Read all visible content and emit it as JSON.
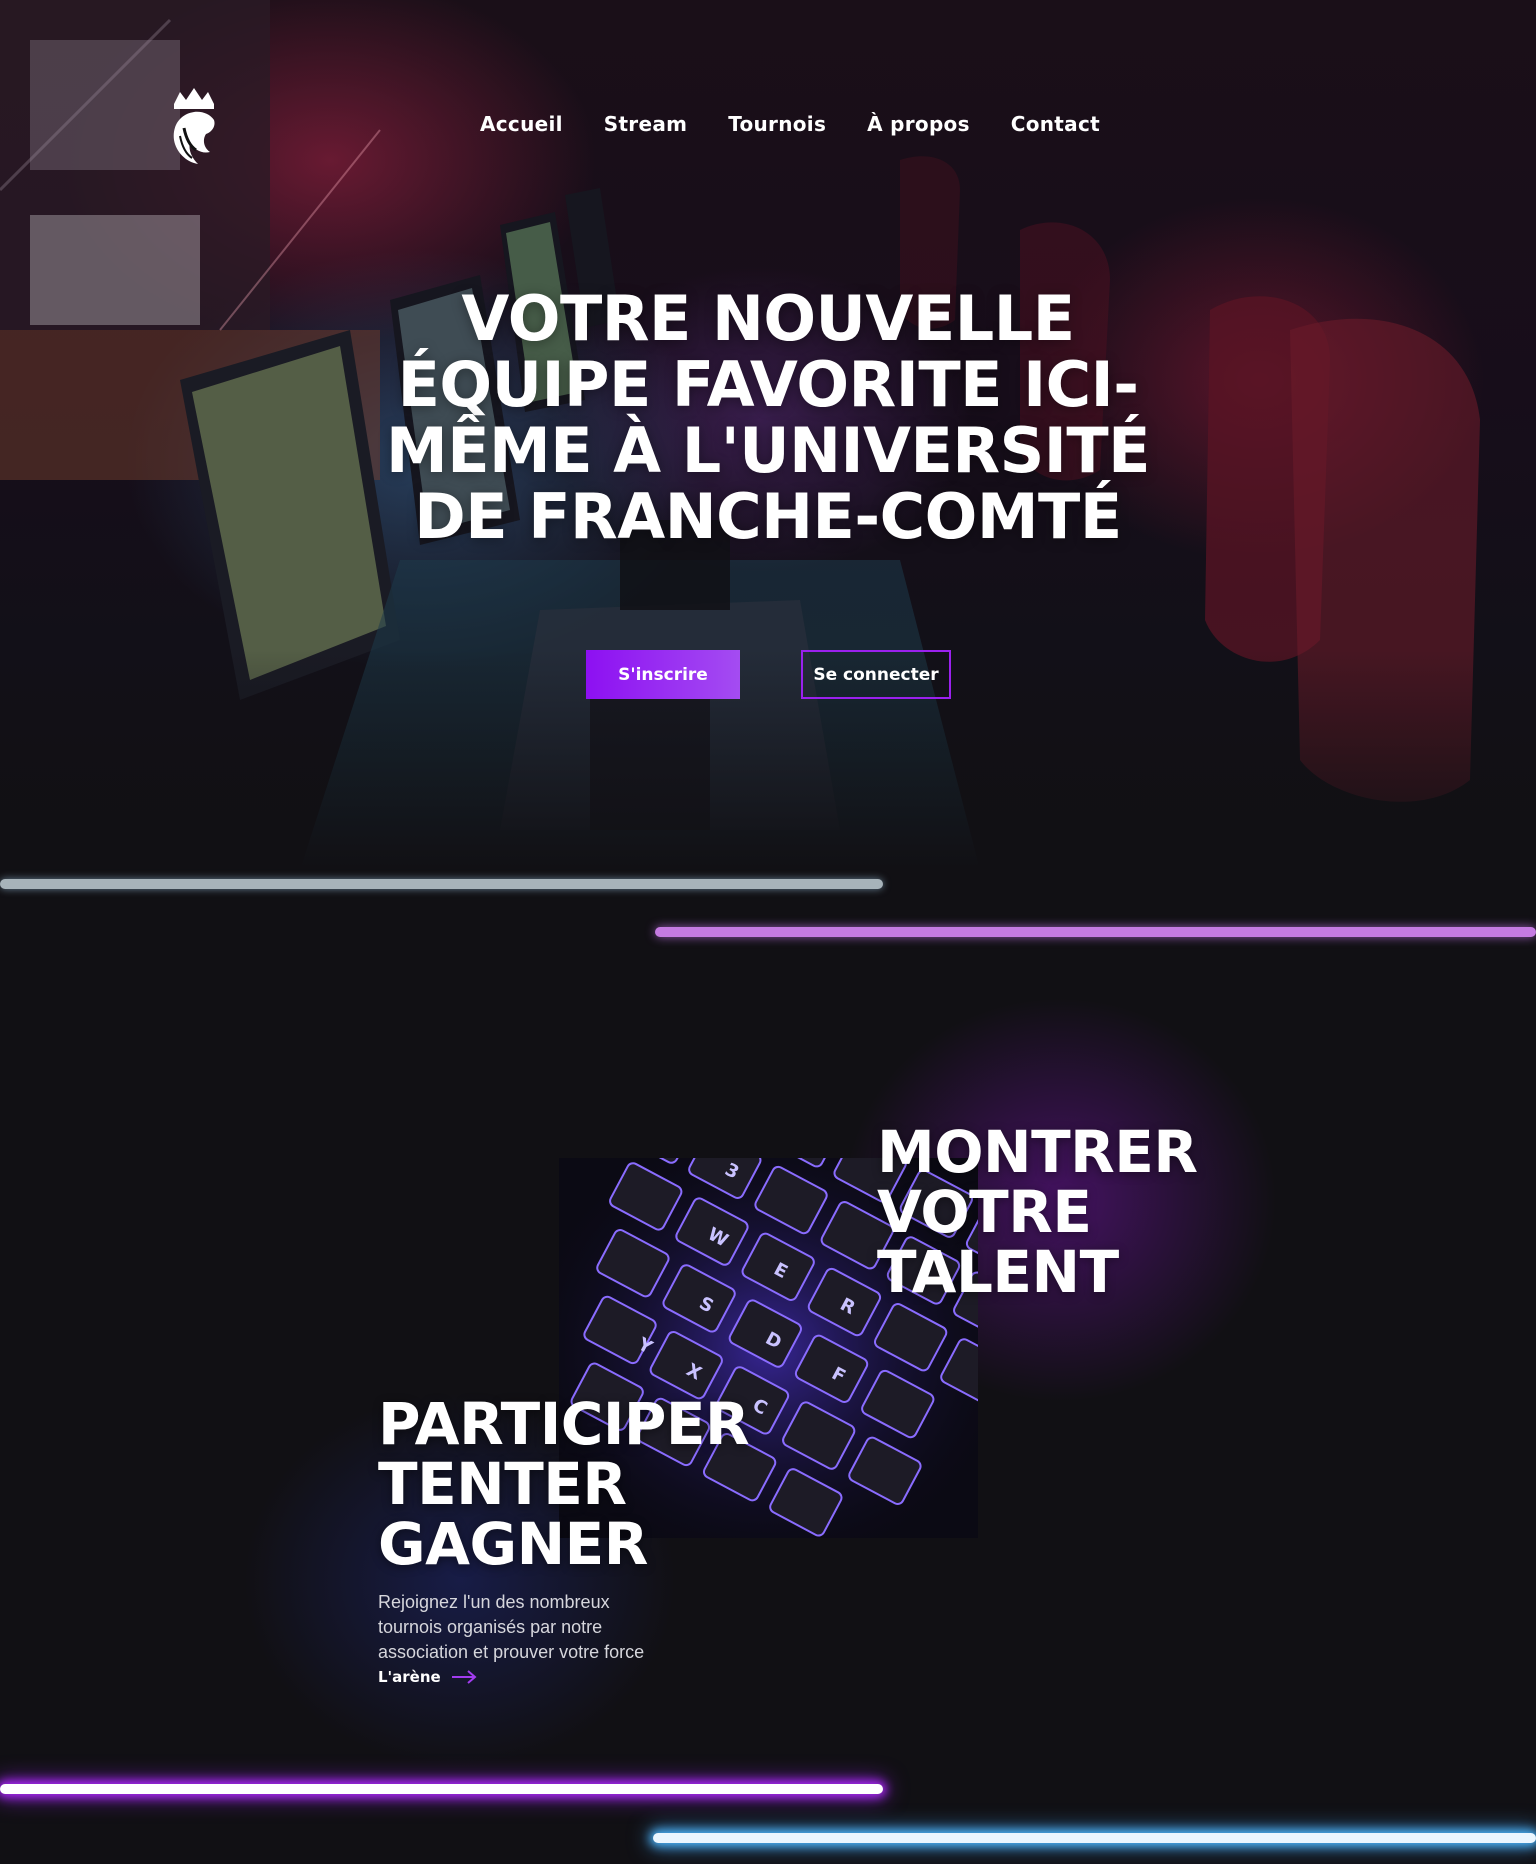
{
  "header": {
    "logo_icon": "crowned-lion-icon",
    "nav": [
      {
        "label": "Accueil"
      },
      {
        "label": "Stream"
      },
      {
        "label": "Tournois"
      },
      {
        "label": "À propos"
      },
      {
        "label": "Contact"
      }
    ]
  },
  "hero": {
    "title": "Votre nouvelle équipe favorite ici-même à l'Université de Franche-Comté",
    "primary_button": "S'inscrire",
    "secondary_button": "Se connecter"
  },
  "talent": {
    "title_lines": [
      "MONTRER",
      "VOTRE",
      "TALENT"
    ]
  },
  "compete": {
    "title_lines": [
      "PARTICIPER",
      "TENTER",
      "GAGNER"
    ],
    "description_lines": [
      "Rejoignez l'un des nombreux",
      "tournois organisés par notre",
      "association et prouver votre force"
    ],
    "link_label": "L'arène",
    "link_icon": "arrow-right-icon"
  },
  "colors": {
    "accent_purple": "#9a21ee",
    "background": "#111014",
    "neon_purple": "#b128ff",
    "neon_blue": "#4db8ff"
  }
}
